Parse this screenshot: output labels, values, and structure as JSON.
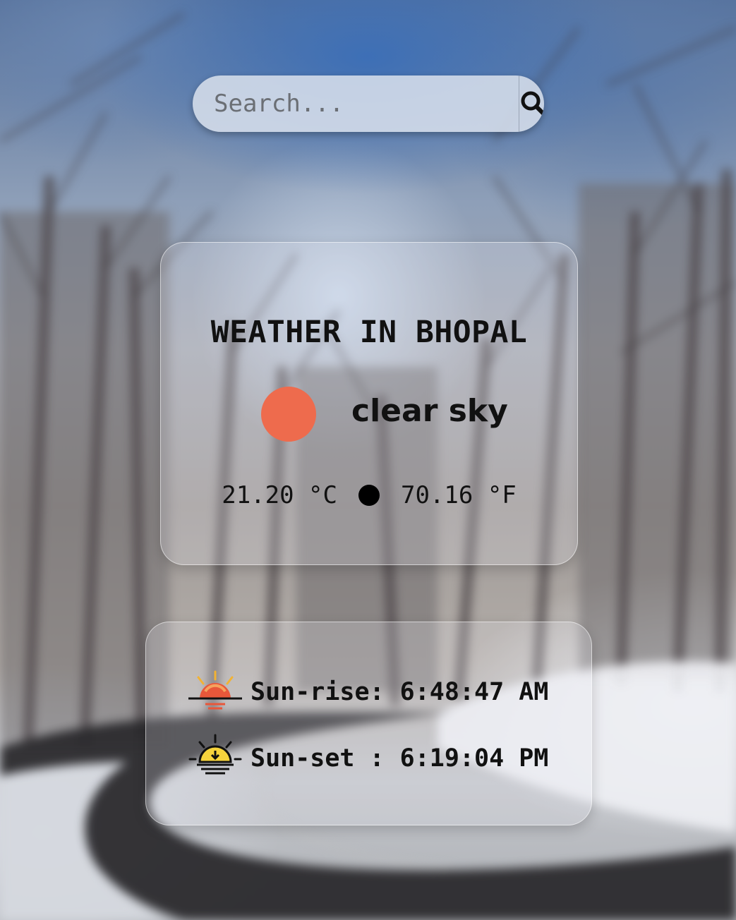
{
  "search": {
    "placeholder": "Search...",
    "button_icon": "search-icon"
  },
  "weather": {
    "title": "WEATHER IN BHOPAL",
    "condition": "clear sky",
    "condition_icon": "condition-dot-icon",
    "condition_color": "#ee6b4d",
    "temp_c": "21.20 °C",
    "temp_f": "70.16 °F"
  },
  "sun": {
    "sunrise_label": "Sun-rise:",
    "sunrise_time": "6:48:47 AM",
    "sunrise_icon": "sunrise-icon",
    "sunset_label": "Sun-set :",
    "sunset_time": "6:19:04 PM",
    "sunset_icon": "sunset-icon"
  }
}
